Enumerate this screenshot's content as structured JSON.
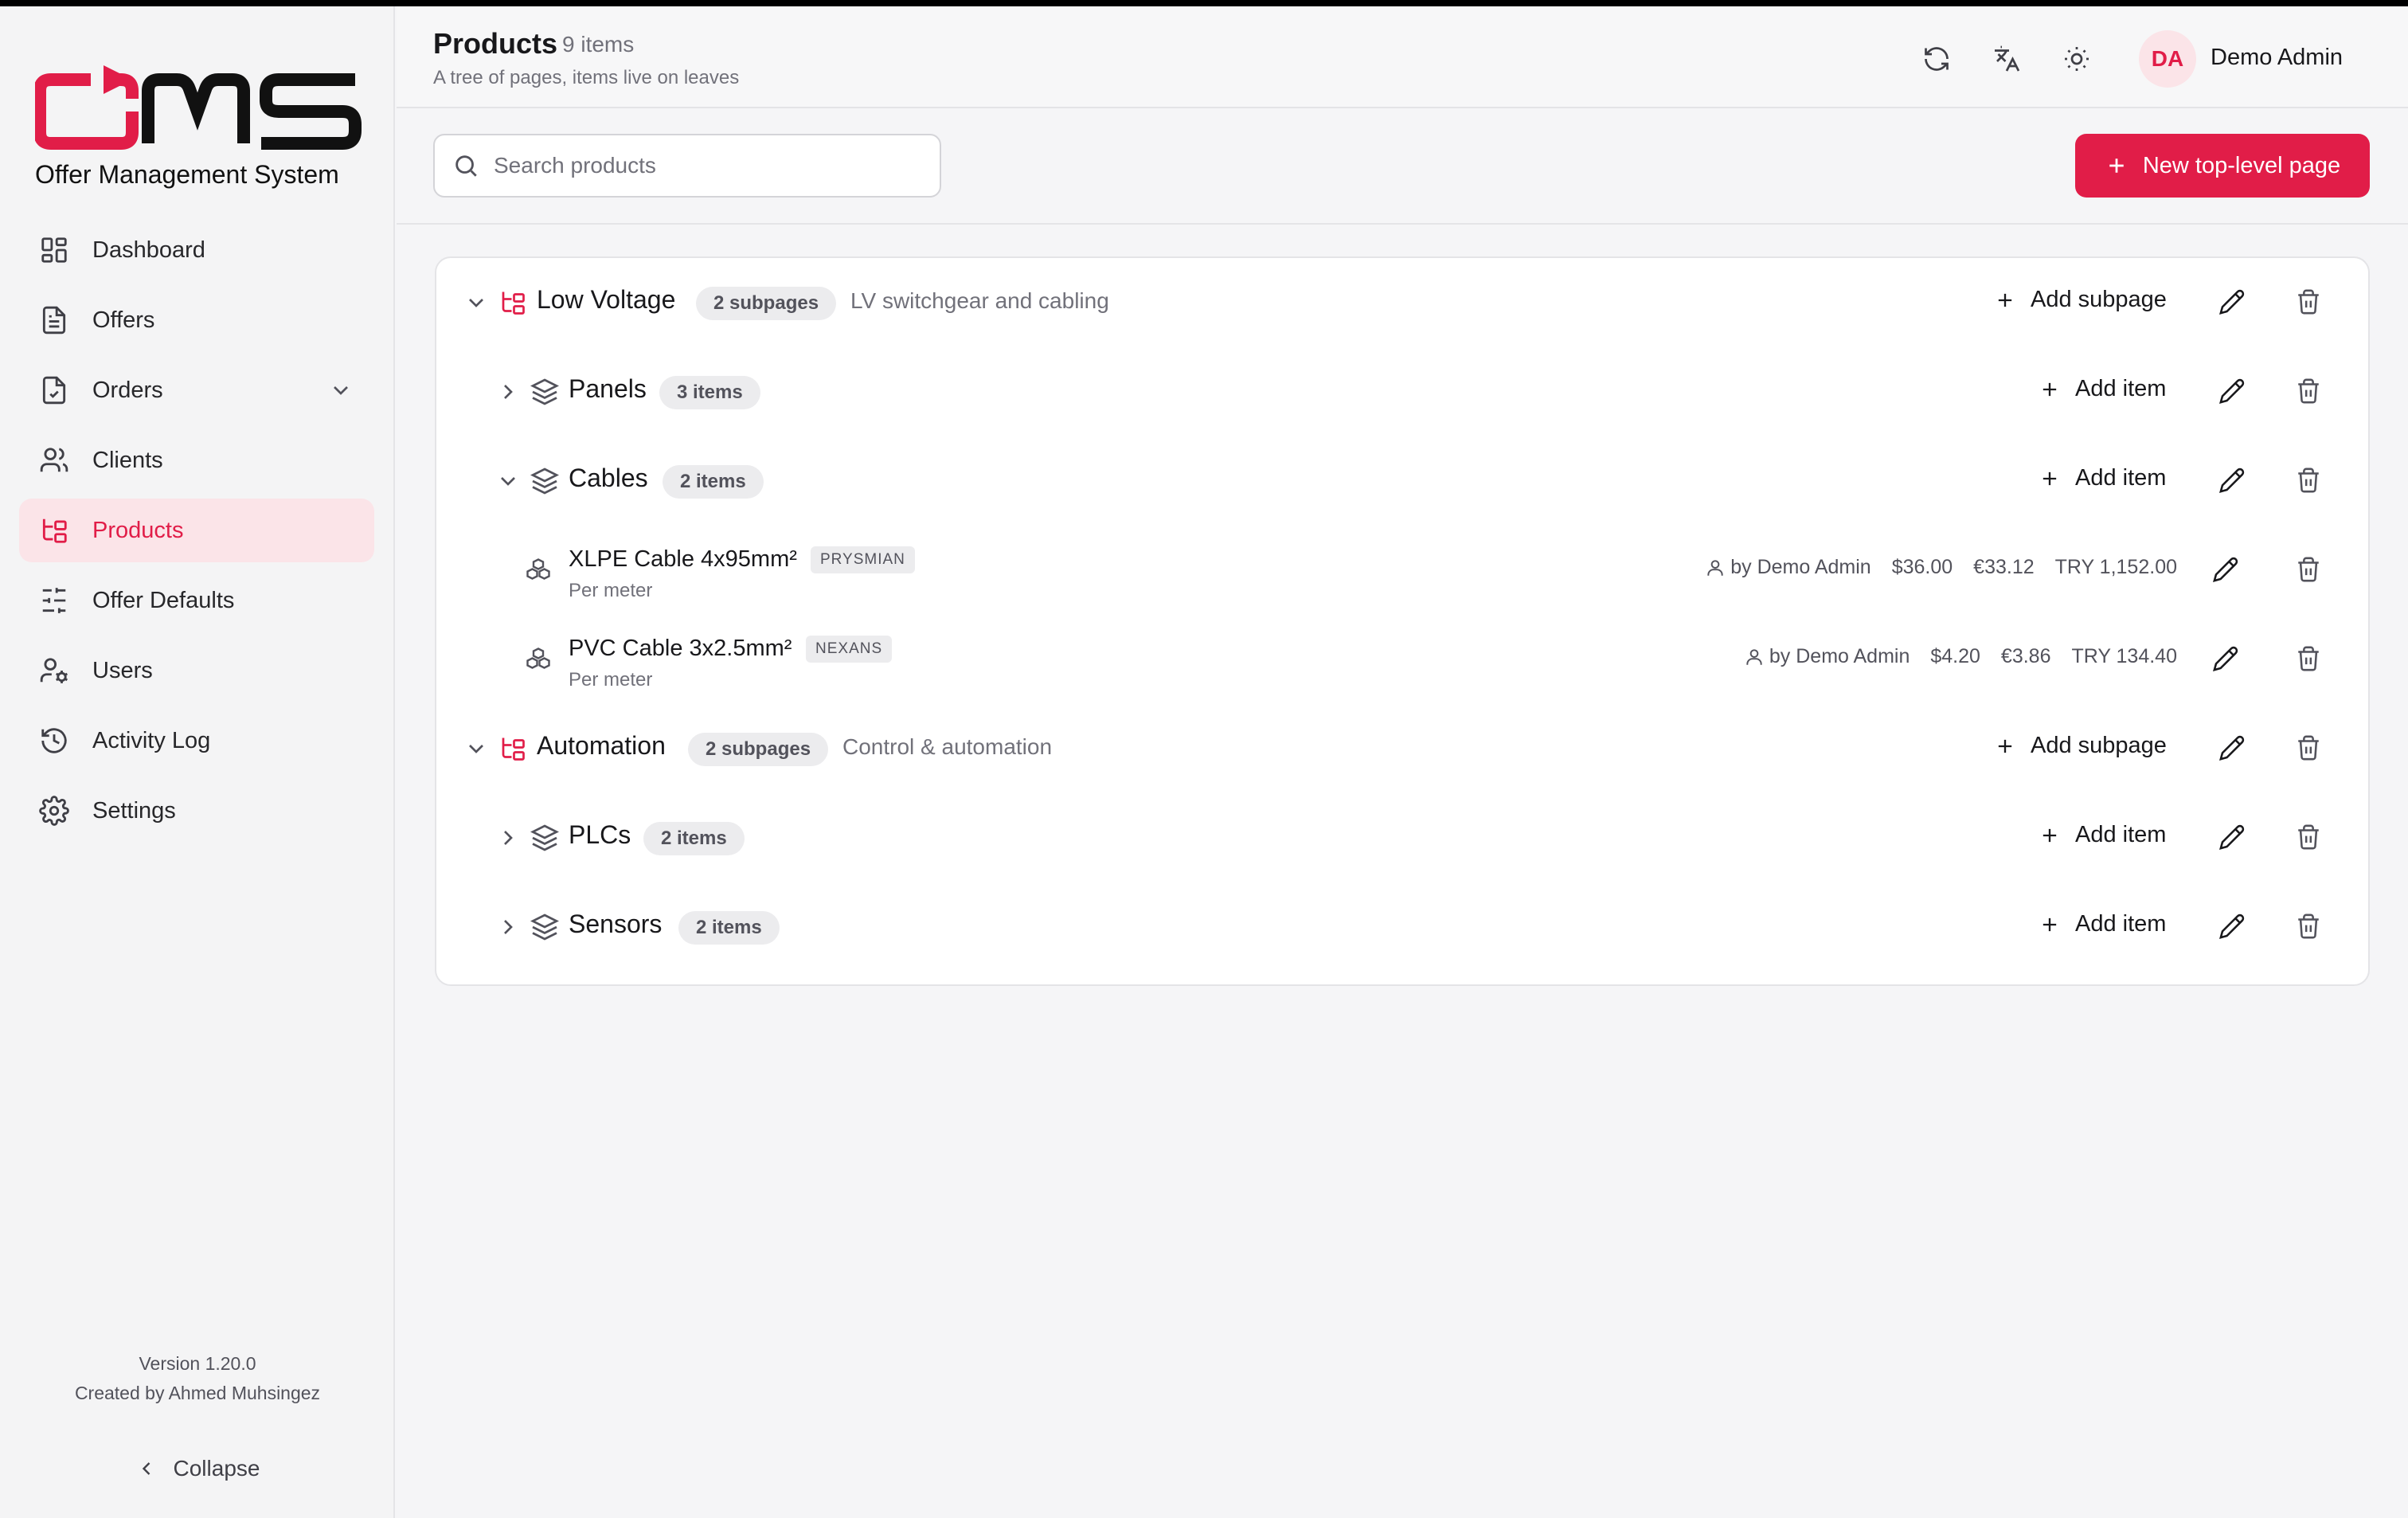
{
  "brand": {
    "logo_text": "OMS",
    "logo_subtitle": "Offer Management System",
    "accent": "#e11d48"
  },
  "sidebar": {
    "items": [
      {
        "label": "Dashboard",
        "icon": "dashboard-icon"
      },
      {
        "label": "Offers",
        "icon": "document-icon"
      },
      {
        "label": "Orders",
        "icon": "file-check-icon",
        "has_children": true
      },
      {
        "label": "Clients",
        "icon": "users-icon"
      },
      {
        "label": "Products",
        "icon": "tree-icon",
        "active": true
      },
      {
        "label": "Offer Defaults",
        "icon": "sliders-icon"
      },
      {
        "label": "Users",
        "icon": "user-cog-icon"
      },
      {
        "label": "Activity Log",
        "icon": "history-icon"
      },
      {
        "label": "Settings",
        "icon": "gear-icon"
      }
    ],
    "version": "Version 1.20.0",
    "credits": "Created by Ahmed Muhsingez",
    "collapse_label": "Collapse"
  },
  "header": {
    "title": "Products",
    "count": "9 items",
    "subtitle": "A tree of pages, items live on leaves",
    "user_initials": "DA",
    "user_name": "Demo Admin"
  },
  "toolbar": {
    "search_placeholder": "Search products",
    "new_page_label": "New top-level page"
  },
  "tree": {
    "add_subpage_label": "Add subpage",
    "add_item_label": "Add item",
    "pages": [
      {
        "name": "Low Voltage",
        "badge": "2 subpages",
        "description": "LV switchgear and cabling",
        "children": [
          {
            "name": "Panels",
            "badge": "3 items"
          },
          {
            "name": "Cables",
            "badge": "2 items",
            "items": [
              {
                "name": "XLPE Cable 4x95mm²",
                "brand": "PRYSMIAN",
                "unit": "Per meter",
                "owner": "by Demo Admin",
                "usd": "$36.00",
                "eur": "€33.12",
                "try": "TRY 1,152.00"
              },
              {
                "name": "PVC Cable 3x2.5mm²",
                "brand": "NEXANS",
                "unit": "Per meter",
                "owner": "by Demo Admin",
                "usd": "$4.20",
                "eur": "€3.86",
                "try": "TRY 134.40"
              }
            ]
          }
        ]
      },
      {
        "name": "Automation",
        "badge": "2 subpages",
        "description": "Control & automation",
        "children": [
          {
            "name": "PLCs",
            "badge": "2 items"
          },
          {
            "name": "Sensors",
            "badge": "2 items"
          }
        ]
      }
    ]
  }
}
